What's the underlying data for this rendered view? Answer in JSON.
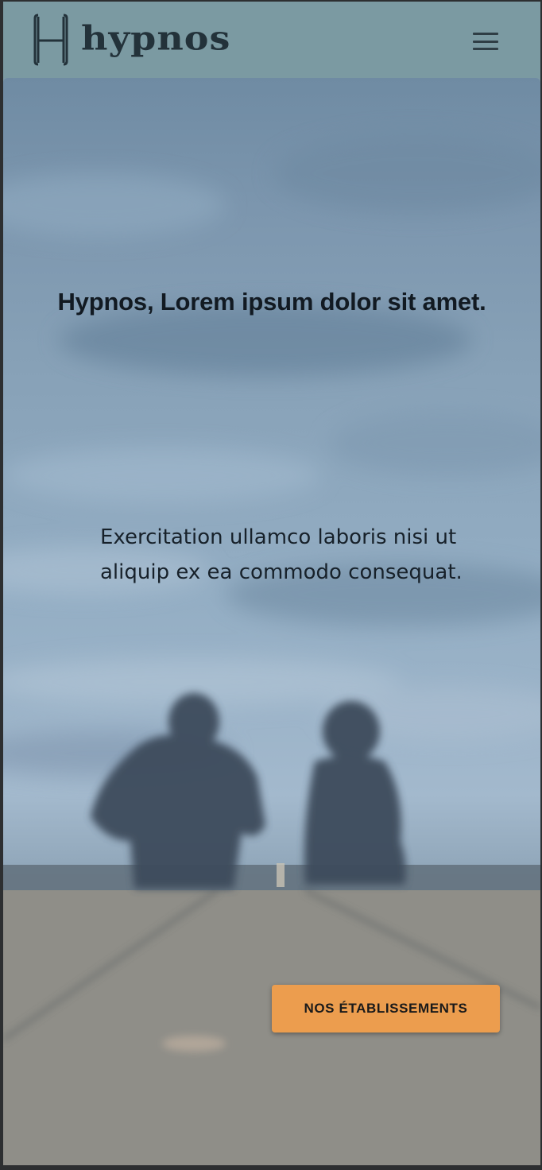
{
  "brand": {
    "name": "hypnos",
    "logo_letter": "H"
  },
  "header": {
    "menu_icon": "hamburger-menu-icon"
  },
  "hero": {
    "headline": "Hypnos, Lorem ipsum dolor sit amet.",
    "subtitle_line1": "Exercitation ullamco laboris nisi ut",
    "subtitle_line2": "aliquip ex ea commodo consequat.",
    "cta_label": "NOS ÉTABLISSEMENTS",
    "background": "two people sitting on a pier under a cloudy sky"
  },
  "colors": {
    "header_bg": "#7b9aa2",
    "logo": "#23323a",
    "cta_bg": "#ec9d4e",
    "text_dark": "#121a22"
  }
}
